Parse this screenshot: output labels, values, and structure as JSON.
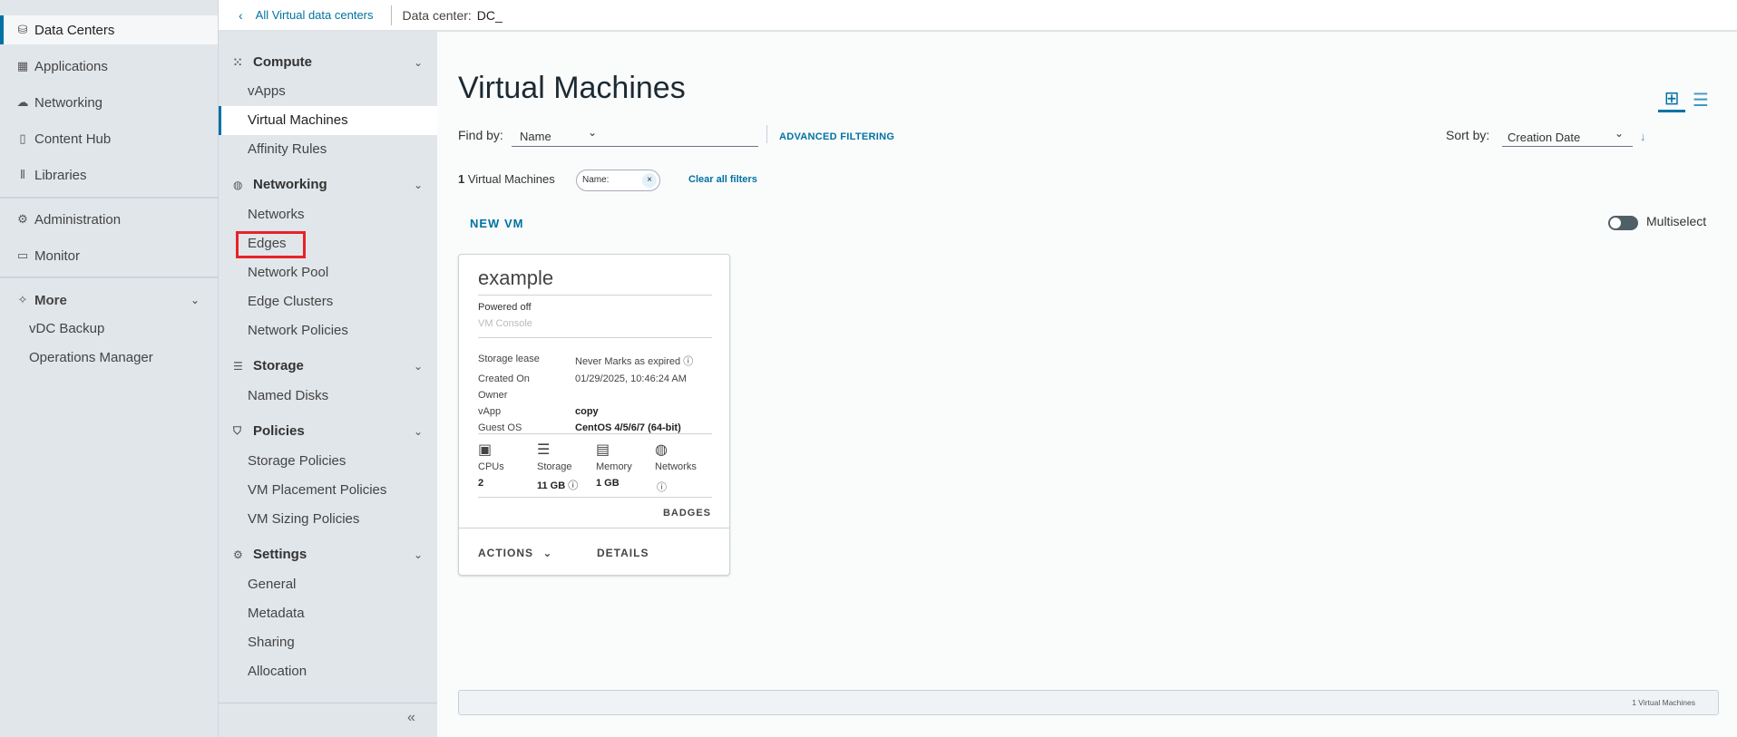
{
  "nav": {
    "items": [
      {
        "label": "Data Centers",
        "icon": "datacenter-icon"
      },
      {
        "label": "Applications",
        "icon": "applications-icon"
      },
      {
        "label": "Networking",
        "icon": "cloud-icon"
      },
      {
        "label": "Content Hub",
        "icon": "content-hub-icon"
      },
      {
        "label": "Libraries",
        "icon": "libraries-icon"
      },
      {
        "label": "Administration",
        "icon": "gear-icon"
      },
      {
        "label": "Monitor",
        "icon": "monitor-icon"
      }
    ],
    "more": {
      "label": "More",
      "items": [
        "vDC Backup",
        "Operations Manager"
      ]
    }
  },
  "topbar": {
    "back_label": "All Virtual data centers",
    "dc_label": "Data center:",
    "dc_value": "DC_"
  },
  "subnav": {
    "compute": {
      "label": "Compute",
      "items": [
        "vApps",
        "Virtual Machines",
        "Affinity Rules"
      ]
    },
    "networking": {
      "label": "Networking",
      "items": [
        "Networks",
        "Edges",
        "Network Pool",
        "Edge Clusters",
        "Network Policies"
      ]
    },
    "storage": {
      "label": "Storage",
      "items": [
        "Named Disks"
      ]
    },
    "policies": {
      "label": "Policies",
      "items": [
        "Storage Policies",
        "VM Placement Policies",
        "VM Sizing Policies"
      ]
    },
    "settings": {
      "label": "Settings",
      "items": [
        "General",
        "Metadata",
        "Sharing",
        "Allocation"
      ]
    },
    "collapse": "«"
  },
  "main": {
    "title": "Virtual Machines",
    "find_by_label": "Find by:",
    "find_by_value": "Name",
    "find_input_value": "",
    "advanced_filtering": "ADVANCED FILTERING",
    "sort_by_label": "Sort by:",
    "sort_by_value": "Creation Date",
    "count_num": "1",
    "count_label": "Virtual Machines",
    "chip_label": "Name:",
    "clear_filters": "Clear all filters",
    "new_vm": "NEW VM",
    "multiselect": "Multiselect",
    "multiselect_on": false,
    "footer_count": "1 Virtual Machines"
  },
  "vm": {
    "name": "example",
    "status": "Powered off",
    "console": "VM Console",
    "props": [
      {
        "k": "Storage lease",
        "v": "Never Marks as expired"
      },
      {
        "k": "Created On",
        "v": "01/29/2025, 10:46:24 AM"
      },
      {
        "k": "Owner",
        "v": ""
      },
      {
        "k": "vApp",
        "v": "copy"
      },
      {
        "k": "Guest OS",
        "v": "CentOS 4/5/6/7 (64-bit)"
      }
    ],
    "stats": [
      {
        "k": "CPUs",
        "v": "2"
      },
      {
        "k": "Storage",
        "v": "11 GB"
      },
      {
        "k": "Memory",
        "v": "1 GB"
      },
      {
        "k": "Networks",
        "v": ""
      }
    ],
    "badges": "BADGES",
    "actions": "ACTIONS",
    "details": "DETAILS"
  },
  "colors": {
    "accent": "#0072a3",
    "highlight": "#e8222a"
  }
}
